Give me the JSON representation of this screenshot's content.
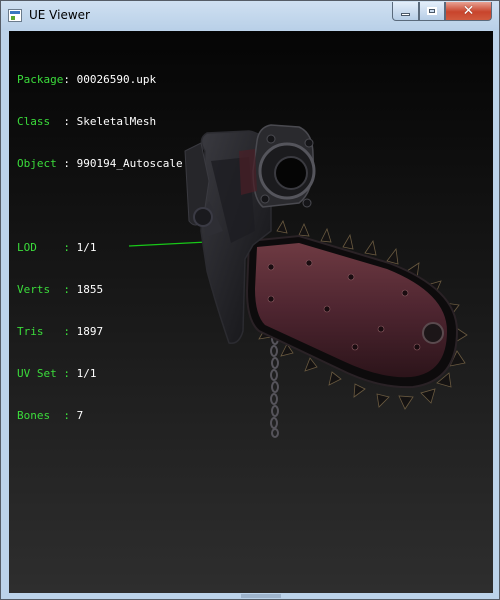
{
  "window": {
    "title": "UE Viewer",
    "close_glyph": "✕"
  },
  "info": {
    "package": {
      "label": "Package",
      "sep": ": ",
      "value": "00026590.upk"
    },
    "class": {
      "label": "Class  ",
      "sep": ": ",
      "value": "SkeletalMesh"
    },
    "object": {
      "label": "Object ",
      "sep": ": ",
      "value": "990194_Autoscale"
    },
    "lod": {
      "label": "LOD    ",
      "sep": ": ",
      "value": "1/1"
    },
    "verts": {
      "label": "Verts  ",
      "sep": ": ",
      "value": "1855"
    },
    "tris": {
      "label": "Tris   ",
      "sep": ": ",
      "value": "1897"
    },
    "uvset": {
      "label": "UV Set ",
      "sep": ": ",
      "value": "1/1"
    },
    "bones": {
      "label": "Bones  ",
      "sep": ": ",
      "value": "7"
    }
  },
  "colors": {
    "label_green": "#3bdc3b",
    "value_white": "#ffffff",
    "title_bar": "#bcd3ea",
    "close_red": "#c8442c"
  },
  "icons": {
    "app": "app-icon",
    "minimize": "minimize-icon",
    "maximize": "maximize-icon",
    "close": "close-icon"
  }
}
